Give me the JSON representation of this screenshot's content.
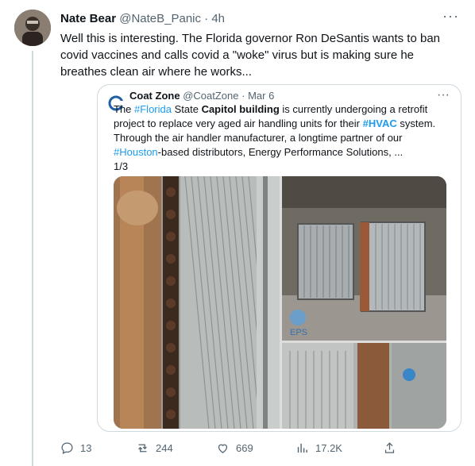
{
  "tweet": {
    "author_name": "Nate Bear",
    "handle": "@NateB_Panic",
    "separator": "·",
    "time": "4h",
    "more": "···",
    "text": "Well this is interesting. The Florida governor Ron DeSantis wants to ban covid vaccines and calls covid a \"woke\" virus but is making sure he breathes clean air where he works..."
  },
  "quote": {
    "author_name": "Coat Zone",
    "handle": "@CoatZone",
    "separator": "·",
    "date": "Mar 6",
    "more": "···",
    "text_parts": [
      {
        "text": "The ",
        "style": "normal"
      },
      {
        "text": "#Florida",
        "style": "hashtag"
      },
      {
        "text": " State ",
        "style": "normal"
      },
      {
        "text": "Capitol building",
        "style": "bold"
      },
      {
        "text": " is currently undergoing a retrofit project to replace very aged air handling units for their ",
        "style": "normal"
      },
      {
        "text": "#HVAC",
        "style": "hashtag-bold"
      },
      {
        "text": " system. Through the air handler manufacturer, a longtime partner of our ",
        "style": "normal"
      },
      {
        "text": "#Houston",
        "style": "hashtag"
      },
      {
        "text": "-based distributors, Energy Performance Solutions, ...",
        "style": "normal"
      }
    ],
    "page": "1/3",
    "logo_text": "COAT ZONE",
    "image_watermark": "EPS"
  },
  "actions": {
    "replies": "13",
    "retweets": "244",
    "likes": "669",
    "views": "17.2K"
  },
  "colors": {
    "link": "#1d9bf0",
    "secondary": "#536471",
    "border": "#cfd9de"
  }
}
